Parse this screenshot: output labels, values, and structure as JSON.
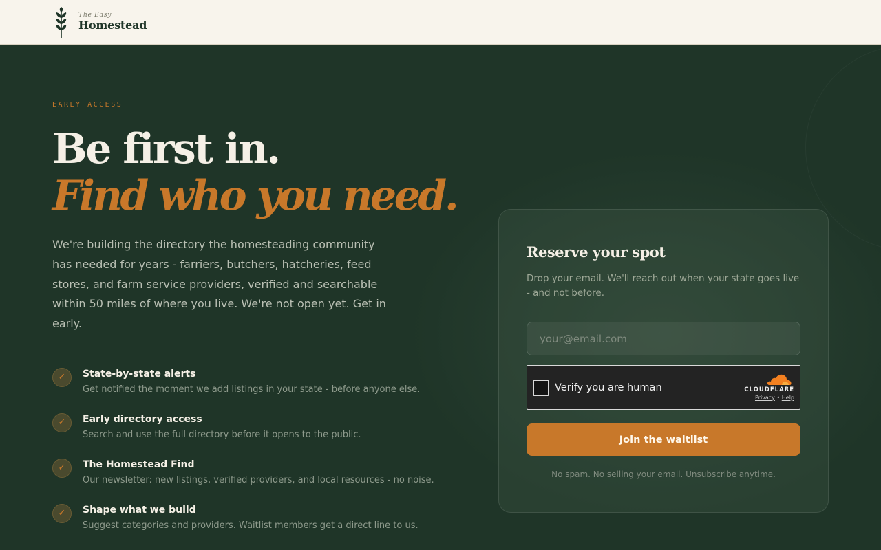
{
  "header": {
    "logo_small": "The Easy",
    "logo_big": "Homestead",
    "logo_icon": "wheat-sprig-icon"
  },
  "hero": {
    "eyebrow": "EARLY ACCESS",
    "headline_line1": "Be first in.",
    "headline_line2": "Find who you need.",
    "intro": "We're building the directory the homesteading community has needed for years - farriers, butchers, hatcheries, feed stores, and farm service providers, verified and searchable within 50 miles of where you live. We're not open yet. Get in early."
  },
  "features": [
    {
      "title": "State-by-state alerts",
      "desc": "Get notified the moment we add listings in your state - before anyone else."
    },
    {
      "title": "Early directory access",
      "desc": "Search and use the full directory before it opens to the public."
    },
    {
      "title": "The Homestead Find",
      "desc": "Our newsletter: new listings, verified providers, and local resources - no noise."
    },
    {
      "title": "Shape what we build",
      "desc": "Suggest categories and providers. Waitlist members get a direct line to us."
    }
  ],
  "form": {
    "title": "Reserve your spot",
    "subtitle": "Drop your email. We'll reach out when your state goes live - and not before.",
    "email_placeholder": "your@email.com",
    "email_value": "",
    "captcha_label": "Verify you are human",
    "captcha_brand": "CLOUDFLARE",
    "captcha_privacy": "Privacy",
    "captcha_sep": "•",
    "captcha_help": "Help",
    "submit_label": "Join the waitlist",
    "fine_print": "No spam. No selling your email. Unsubscribe anytime."
  },
  "colors": {
    "accent": "#c8782a",
    "background": "#1f3528",
    "header_bg": "#f8f4ec"
  }
}
